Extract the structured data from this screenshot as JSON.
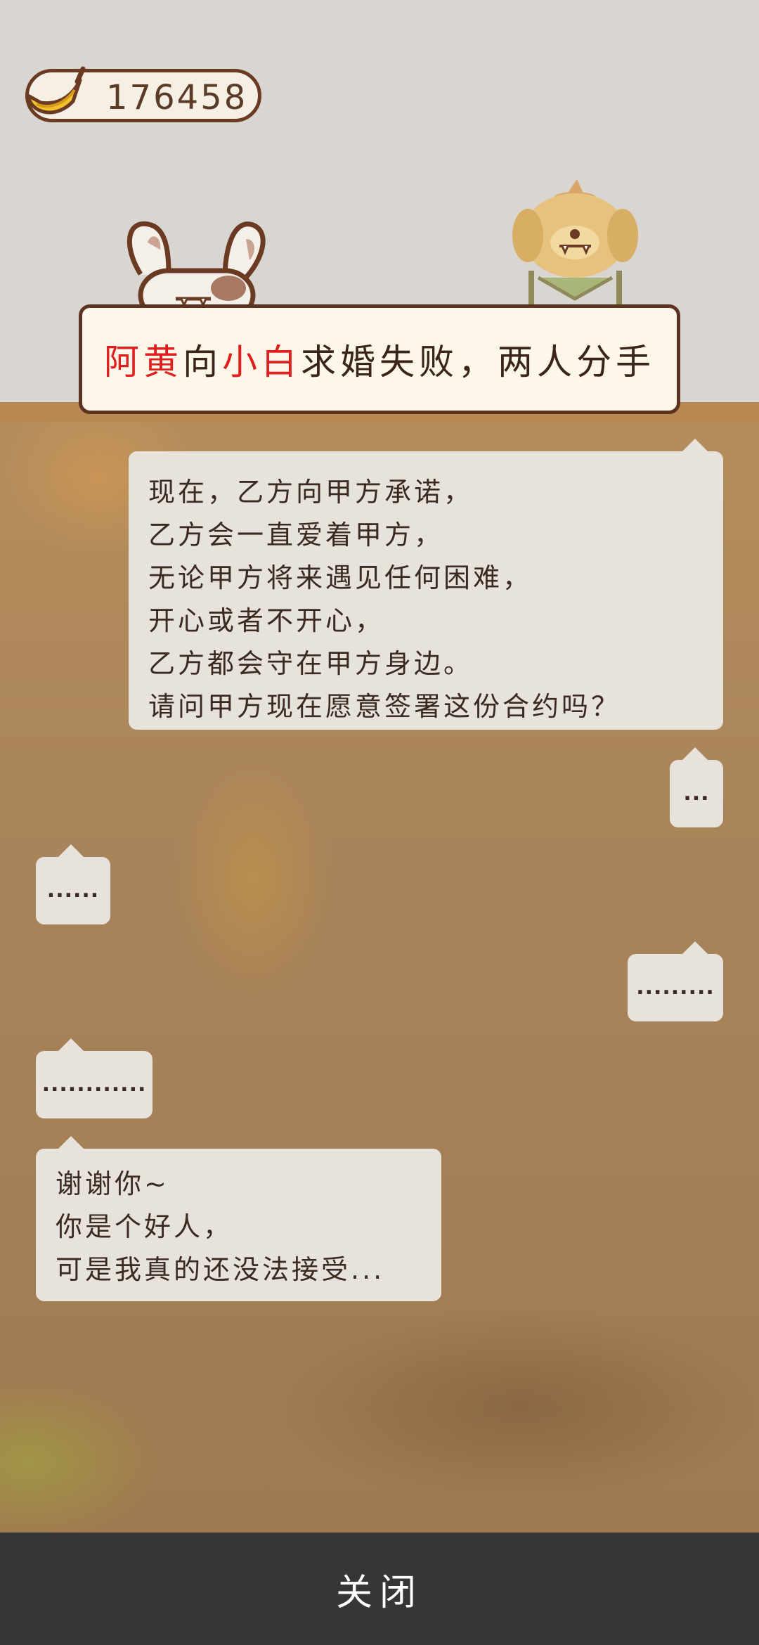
{
  "currency": {
    "icon": "banana-icon",
    "value": "176458"
  },
  "banner": {
    "name_a": "阿黄",
    "connector": "向",
    "name_b": "小白",
    "rest": "求婚失败，两人分手",
    "highlight_color": "#e01e1e"
  },
  "messages": [
    {
      "side": "right",
      "lines": [
        "现在，乙方向甲方承诺，",
        "乙方会一直爱着甲方，",
        "无论甲方将来遇见任何困难，",
        "开心或者不开心，",
        "乙方都会守在甲方身边。",
        "请问甲方现在愿意签署这份合约吗？"
      ]
    },
    {
      "side": "right",
      "text": "..."
    },
    {
      "side": "left",
      "text": "......"
    },
    {
      "side": "right",
      "text": "........."
    },
    {
      "side": "left",
      "text": "............"
    },
    {
      "side": "left",
      "lines": [
        "谢谢你~",
        "你是个好人，",
        "可是我真的还没法接受..."
      ]
    }
  ],
  "footer": {
    "close_label": "关闭"
  }
}
